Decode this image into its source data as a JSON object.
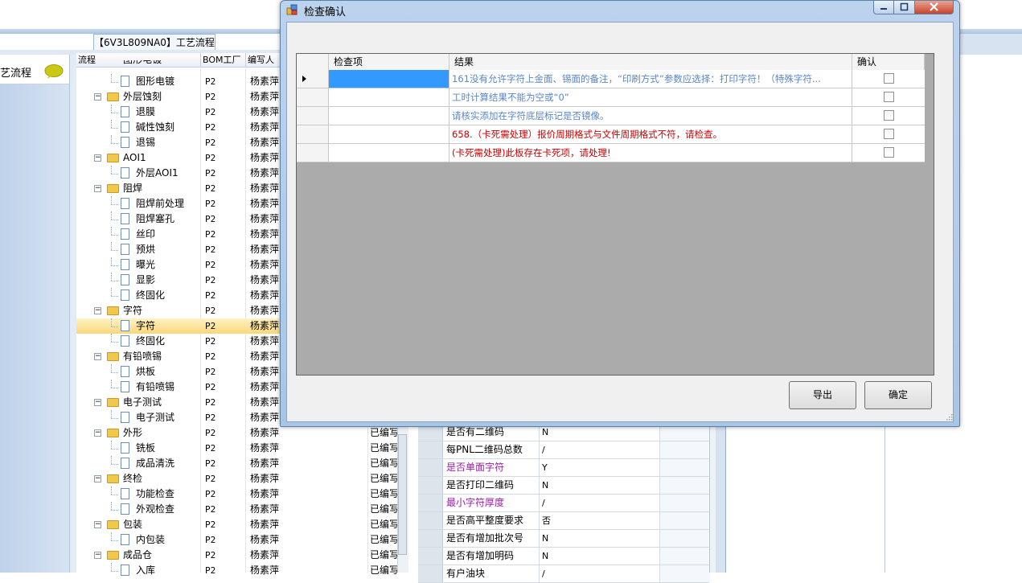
{
  "doc_tab": "【6V3L809NA0】工艺流程",
  "left_panel": {
    "title": "艺流程"
  },
  "tree": {
    "headers": [
      "流程",
      "BOM工厂",
      "编写人"
    ],
    "top_partial": "图形电镀",
    "rows": [
      {
        "name": "图形电镀",
        "type": "file",
        "bom": "P2",
        "writer": "杨素萍"
      },
      {
        "name": "外层蚀刻",
        "type": "folder",
        "bom": "P2",
        "writer": "杨素萍"
      },
      {
        "name": "退膜",
        "type": "file",
        "bom": "P2",
        "writer": "杨素萍"
      },
      {
        "name": "碱性蚀刻",
        "type": "file",
        "bom": "P2",
        "writer": "杨素萍"
      },
      {
        "name": "退锡",
        "type": "file",
        "bom": "P2",
        "writer": "杨素萍"
      },
      {
        "name": "AOI1",
        "type": "folder",
        "bom": "P2",
        "writer": "杨素萍"
      },
      {
        "name": "外层AOI1",
        "type": "file",
        "bom": "P2",
        "writer": "杨素萍"
      },
      {
        "name": "阻焊",
        "type": "folder",
        "bom": "P2",
        "writer": "杨素萍"
      },
      {
        "name": "阻焊前处理",
        "type": "file",
        "bom": "P2",
        "writer": "杨素萍"
      },
      {
        "name": "阻焊塞孔",
        "type": "file",
        "bom": "P2",
        "writer": "杨素萍"
      },
      {
        "name": "丝印",
        "type": "file",
        "bom": "P2",
        "writer": "杨素萍"
      },
      {
        "name": "预烘",
        "type": "file",
        "bom": "P2",
        "writer": "杨素萍"
      },
      {
        "name": "曝光",
        "type": "file",
        "bom": "P2",
        "writer": "杨素萍"
      },
      {
        "name": "显影",
        "type": "file",
        "bom": "P2",
        "writer": "杨素萍"
      },
      {
        "name": "终固化",
        "type": "file",
        "bom": "P2",
        "writer": "杨素萍"
      },
      {
        "name": "字符",
        "type": "folder",
        "bom": "P2",
        "writer": "杨素萍"
      },
      {
        "name": "字符",
        "type": "file",
        "bom": "P2",
        "writer": "杨素萍",
        "selected": true
      },
      {
        "name": "终固化",
        "type": "file",
        "bom": "P2",
        "writer": "杨素萍"
      },
      {
        "name": "有铅喷锡",
        "type": "folder",
        "bom": "P2",
        "writer": "杨素萍"
      },
      {
        "name": "烘板",
        "type": "file",
        "bom": "P2",
        "writer": "杨素萍"
      },
      {
        "name": "有铅喷锡",
        "type": "file",
        "bom": "P2",
        "writer": "杨素萍"
      },
      {
        "name": "电子测试",
        "type": "folder",
        "bom": "P2",
        "writer": "杨素萍"
      },
      {
        "name": "电子测试",
        "type": "file",
        "bom": "P2",
        "writer": "杨素萍"
      },
      {
        "name": "外形",
        "type": "folder",
        "bom": "P2",
        "writer": "杨素萍",
        "status": "已编写"
      },
      {
        "name": "铣板",
        "type": "file",
        "bom": "P2",
        "writer": "杨素萍",
        "status": "已编写"
      },
      {
        "name": "成品清洗",
        "type": "file",
        "bom": "P2",
        "writer": "杨素萍",
        "status": "已编写"
      },
      {
        "name": "终检",
        "type": "folder",
        "bom": "P2",
        "writer": "杨素萍",
        "status": "已编写"
      },
      {
        "name": "功能检查",
        "type": "file",
        "bom": "P2",
        "writer": "杨素萍",
        "status": "已编写"
      },
      {
        "name": "外观检查",
        "type": "file",
        "bom": "P2",
        "writer": "杨素萍",
        "status": "已编写"
      },
      {
        "name": "包装",
        "type": "folder",
        "bom": "P2",
        "writer": "杨素萍",
        "status": "已编写"
      },
      {
        "name": "内包装",
        "type": "file",
        "bom": "P2",
        "writer": "杨素萍",
        "status": "已编写"
      },
      {
        "name": "成品仓",
        "type": "folder",
        "bom": "P2",
        "writer": "杨素萍",
        "status": "已编写"
      },
      {
        "name": "入库",
        "type": "file",
        "bom": "P2",
        "writer": "杨素萍",
        "status": "已编写"
      }
    ]
  },
  "property_grid": [
    {
      "name": "是否有二维码",
      "value": "N"
    },
    {
      "name": "每PNL二维码总数",
      "value": "/"
    },
    {
      "name": "是否单面字符",
      "value": "Y",
      "highlight": true
    },
    {
      "name": "是否打印二维码",
      "value": "N"
    },
    {
      "name": "最小字符厚度",
      "value": "/",
      "highlight": true
    },
    {
      "name": "是否高平整度要求",
      "value": "否"
    },
    {
      "name": "是否有增加批次号",
      "value": "N"
    },
    {
      "name": "是否有增加明码",
      "value": "N"
    },
    {
      "name": "有户油块",
      "value": "/"
    }
  ],
  "dialog": {
    "title": "检查确认",
    "headers": {
      "item": "检查项",
      "result": "结果",
      "confirm": "确认"
    },
    "rows": [
      {
        "item": "",
        "result": "161没有允许字符上金面、锡面的备注，“印刷方式”参数应选择：打印字符！（特殊字符...",
        "color": "blue",
        "current": true
      },
      {
        "item": "",
        "result": "工时计算结果不能为空或“0”",
        "color": "blue"
      },
      {
        "item": "",
        "result": "请核实添加在字符底层标记是否镜像。",
        "color": "blue"
      },
      {
        "item": "",
        "result": "658.（卡死需处理）报价周期格式与文件周期格式不符，请检查。",
        "color": "red"
      },
      {
        "item": "",
        "result": "(卡死需处理)此板存在卡死项，请处理!",
        "color": "red"
      }
    ],
    "buttons": {
      "export": "导出",
      "ok": "确定"
    }
  },
  "colors": {
    "blue_text": "#5a86c5",
    "red_text": "#c80000",
    "selection": "#3399ff",
    "highlight_text": "#9b1fa8"
  }
}
